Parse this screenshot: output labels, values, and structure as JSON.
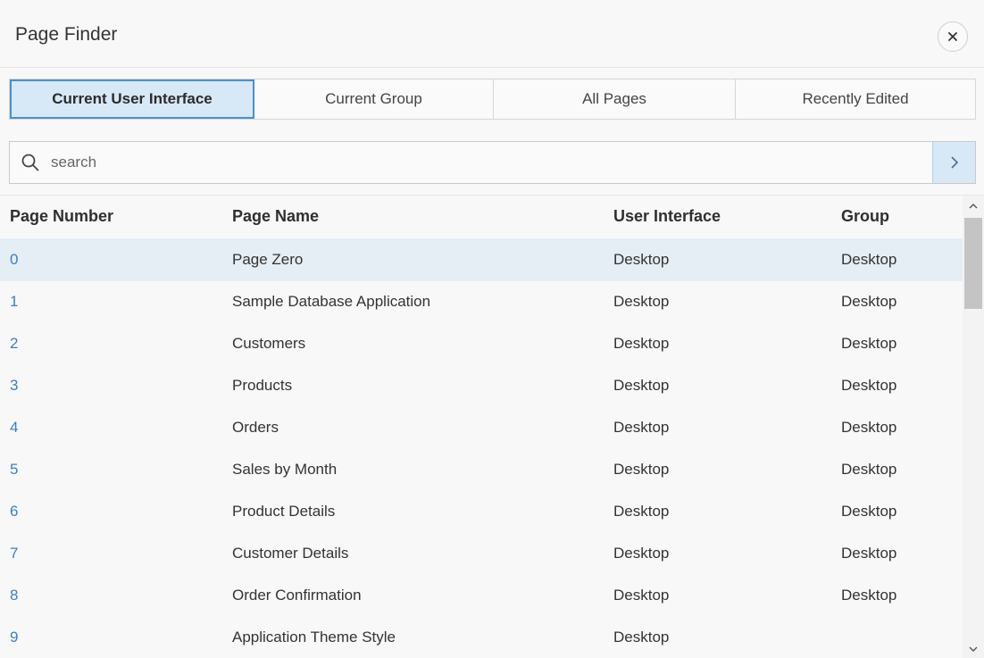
{
  "dialog": {
    "title": "Page Finder",
    "close_icon": "close-icon"
  },
  "tabs": [
    {
      "label": "Current User Interface",
      "active": true
    },
    {
      "label": "Current Group",
      "active": false
    },
    {
      "label": "All Pages",
      "active": false
    },
    {
      "label": "Recently Edited",
      "active": false
    }
  ],
  "search": {
    "placeholder": "search",
    "value": "",
    "icon": "search-icon",
    "go_icon": "chevron-right-icon"
  },
  "table": {
    "columns": [
      "Page Number",
      "Page Name",
      "User Interface",
      "Group"
    ],
    "rows": [
      {
        "number": "0",
        "name": "Page Zero",
        "ui": "Desktop",
        "group": "Desktop"
      },
      {
        "number": "1",
        "name": "Sample Database Application",
        "ui": "Desktop",
        "group": "Desktop"
      },
      {
        "number": "2",
        "name": "Customers",
        "ui": "Desktop",
        "group": "Desktop"
      },
      {
        "number": "3",
        "name": "Products",
        "ui": "Desktop",
        "group": "Desktop"
      },
      {
        "number": "4",
        "name": "Orders",
        "ui": "Desktop",
        "group": "Desktop"
      },
      {
        "number": "5",
        "name": "Sales by Month",
        "ui": "Desktop",
        "group": "Desktop"
      },
      {
        "number": "6",
        "name": "Product Details",
        "ui": "Desktop",
        "group": "Desktop"
      },
      {
        "number": "7",
        "name": "Customer Details",
        "ui": "Desktop",
        "group": "Desktop"
      },
      {
        "number": "8",
        "name": "Order Confirmation",
        "ui": "Desktop",
        "group": "Desktop"
      },
      {
        "number": "9",
        "name": "Application Theme Style",
        "ui": "Desktop",
        "group": ""
      }
    ],
    "selected_row": 0
  },
  "colors": {
    "accent": "#4b90c9",
    "link": "#3b7fc4",
    "selected_row_bg": "#e5edf5",
    "active_tab_bg": "#d7e8f7"
  }
}
